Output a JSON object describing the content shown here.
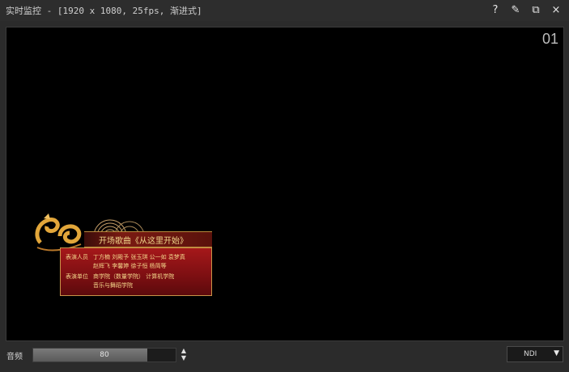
{
  "window": {
    "title": "实时监控 - [1920 x 1080, 25fps, 渐进式]",
    "help_icon": "?",
    "pin_icon": "✎",
    "restore_icon": "⧉",
    "close_icon": "×"
  },
  "viewport": {
    "channel": "01",
    "overlay": {
      "song": "开场歌曲《从这里开始》",
      "performers_label": "表演人员",
      "performers_line1": "丁方楠 刘殿予 张玉琪 公一如 袁梦真",
      "performers_line2": "赵辉飞 李馨婷 徐子恒 杨简等",
      "units_label": "表演单位",
      "units_line1": "商学院（数量学院） 计算机学院",
      "units_line2": "音乐与舞蹈学院"
    }
  },
  "bottom": {
    "volume_label": "音频",
    "volume_value": "80",
    "volume_fraction": 0.8,
    "source_value": "NDI",
    "stepper_up": "▲",
    "stepper_down": "▼",
    "dropdown_arrow": "▼"
  }
}
